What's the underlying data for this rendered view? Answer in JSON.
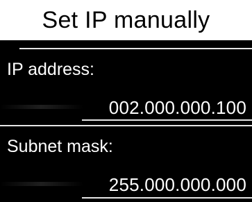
{
  "header": {
    "title": "Set IP manually"
  },
  "fields": {
    "ip_address": {
      "label": "IP address:",
      "value": "002.000.000.100"
    },
    "subnet_mask": {
      "label": "Subnet mask:",
      "value": "255.000.000.000"
    }
  },
  "colors": {
    "background": "#000000",
    "title_background": "#ffffff",
    "title_text": "#000000",
    "text": "#ffffff",
    "divider": "#e5e5e5"
  }
}
